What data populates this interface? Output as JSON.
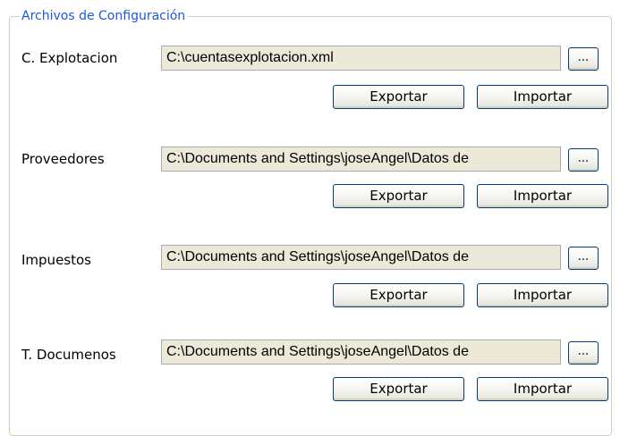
{
  "group": {
    "title": "Archivos de Configuración"
  },
  "rows": [
    {
      "label": "C. Explotacion",
      "path": "C:\\cuentasexplotacion.xml",
      "browse_label": "...",
      "export_label": "Exportar",
      "import_label": "Importar"
    },
    {
      "label": "Proveedores",
      "path": "C:\\Documents and Settings\\joseAngel\\Datos de",
      "browse_label": "...",
      "export_label": "Exportar",
      "import_label": "Importar"
    },
    {
      "label": "Impuestos",
      "path": "C:\\Documents and Settings\\joseAngel\\Datos de",
      "browse_label": "...",
      "export_label": "Exportar",
      "import_label": "Importar"
    },
    {
      "label": "T. Documenos",
      "path": "C:\\Documents and Settings\\joseAngel\\Datos de",
      "browse_label": "...",
      "export_label": "Exportar",
      "import_label": "Importar"
    }
  ]
}
